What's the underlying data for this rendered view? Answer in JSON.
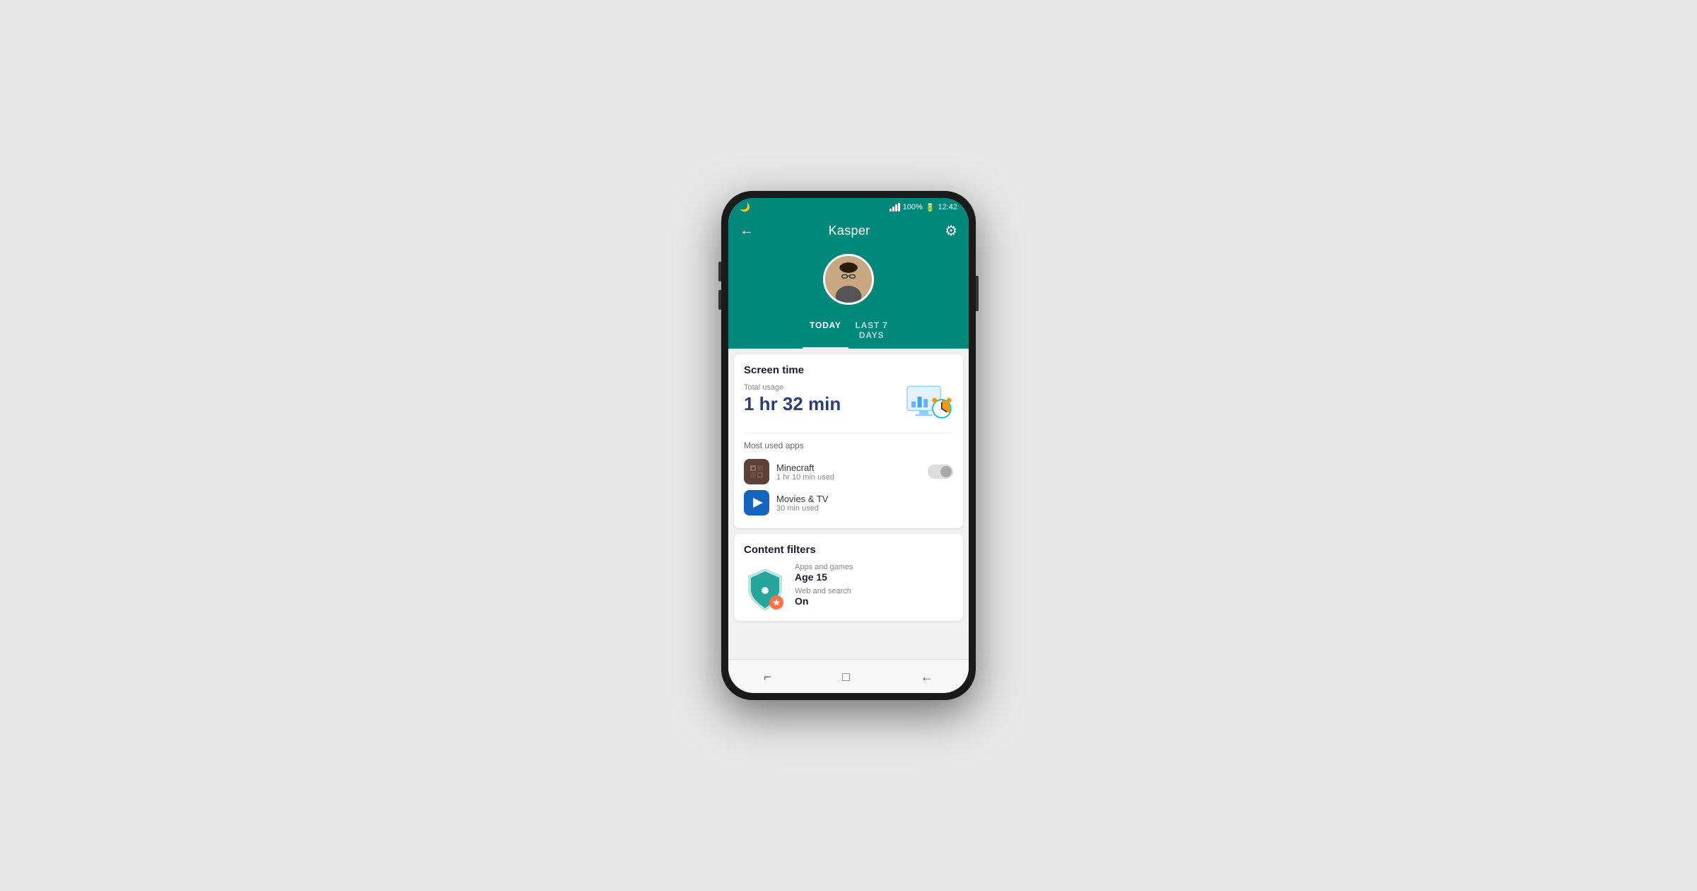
{
  "status_bar": {
    "time": "12:42",
    "battery": "100%",
    "moon_icon": "🌙"
  },
  "header": {
    "back_label": "←",
    "title": "Kasper",
    "settings_icon": "⚙"
  },
  "tabs": [
    {
      "id": "today",
      "label": "TODAY",
      "active": true
    },
    {
      "id": "last7",
      "label": "LAST 7 DAYS",
      "active": false
    }
  ],
  "screen_time": {
    "section_title": "Screen time",
    "total_usage_label": "Total usage",
    "total_usage_value": "1 hr 32 min",
    "most_used_label": "Most used apps",
    "apps": [
      {
        "name": "Minecraft",
        "usage": "1 hr 10 min used",
        "icon_type": "minecraft"
      },
      {
        "name": "Movies & TV",
        "usage": "30 min used",
        "icon_type": "movies"
      }
    ]
  },
  "content_filters": {
    "section_title": "Content filters",
    "apps_games_label": "Apps and games",
    "apps_games_value": "Age 15",
    "web_search_label": "Web and search",
    "web_search_value": "On"
  },
  "bottom_nav": {
    "recent_icon": "⌐",
    "home_icon": "□",
    "back_icon": "←"
  }
}
